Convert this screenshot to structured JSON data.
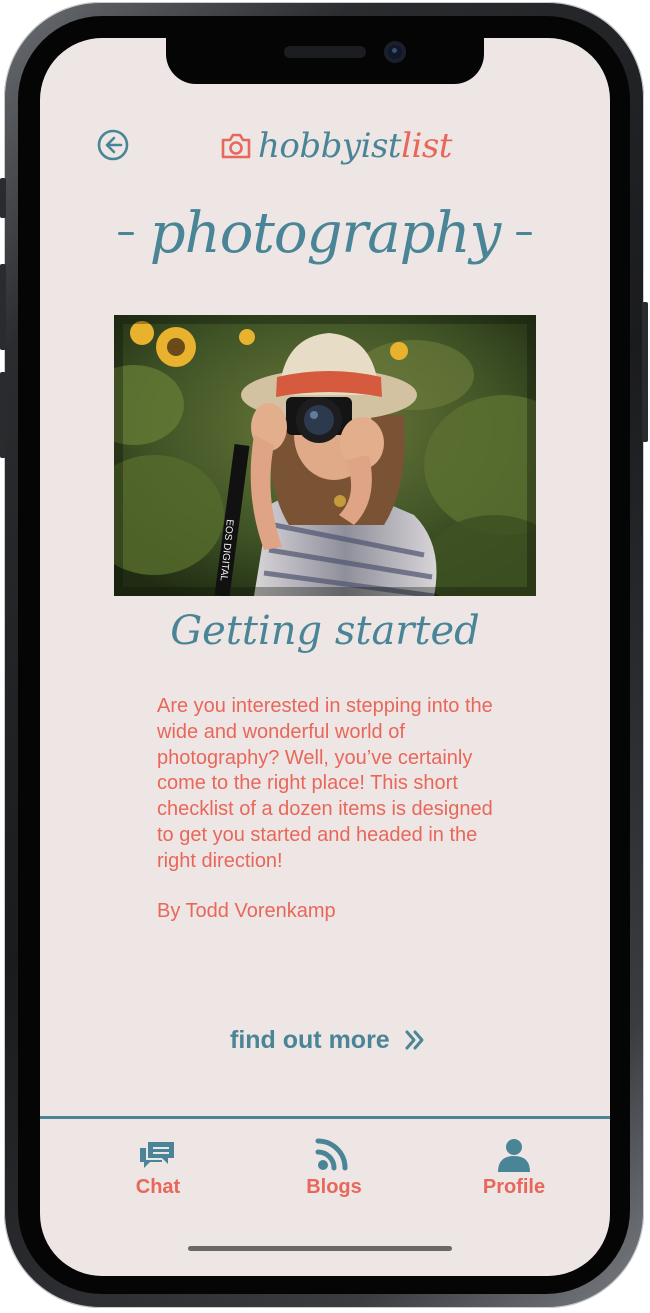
{
  "header": {
    "brand_main": "hobbyist",
    "brand_accent": "list",
    "page_title": "photography"
  },
  "article": {
    "heading": "Getting started",
    "body": "Are you interested in stepping into the wide and wonderful world of photography? Well, you’ve certainly come to the right place! This short checklist of a dozen items is designed to get you started and headed in the right direction!",
    "author": "By Todd Vorenkamp",
    "cta_label": "find out more",
    "strap_text": "EOS DIGITAL"
  },
  "nav": {
    "items": [
      {
        "label": "Chat",
        "icon": "chat-icon"
      },
      {
        "label": "Blogs",
        "icon": "rss-icon"
      },
      {
        "label": "Profile",
        "icon": "person-icon"
      }
    ]
  },
  "colors": {
    "accent_teal": "#4a8597",
    "accent_coral": "#e8675a",
    "background": "#ede6e4"
  }
}
